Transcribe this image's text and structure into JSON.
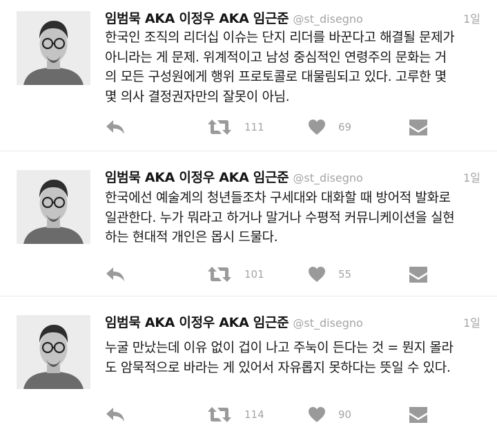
{
  "tweets": [
    {
      "author_name": "임범묵 AKA 이정우 AKA 임근준",
      "handle": "@st_disegno",
      "time": "1일",
      "lines": [
        "한국인 조직의 리더십 이슈는 단지 리더를 바꾼다고 해결될 문제가",
        "아니라는 게 문제. 위계적이고 남성 중심적인 연령주의 문화는 거",
        "의 모든 구성원에게 행위 프로토콜로 대물림되고 있다. 고루한 몇",
        "몇 의사 결정권자만의 잘못이 아님."
      ],
      "retweets": "111",
      "likes": "69"
    },
    {
      "author_name": "임범묵 AKA 이정우 AKA 임근준",
      "handle": "@st_disegno",
      "time": "1일",
      "lines": [
        "한국에선 예술계의 청년들조차 구세대와 대화할 때 방어적 발화로",
        "일관한다. 누가 뭐라고 하거나 말거나 수평적 커뮤니케이션을 실현",
        "하는 현대적 개인은 몹시 드물다."
      ],
      "retweets": "101",
      "likes": "55"
    },
    {
      "author_name": "임범묵 AKA 이정우 AKA 임근준",
      "handle": "@st_disegno",
      "time": "1일",
      "lines": [
        "누굴 만났는데 이유 없이 겁이 나고 주눅이 든다는 것 = 뭔지 몰라",
        "도 암묵적으로 바라는 게 있어서 자유롭지 못하다는 뜻일 수 있다."
      ],
      "retweets": "114",
      "likes": "90"
    }
  ],
  "icons": {
    "reply": "reply-icon",
    "retweet": "retweet-icon",
    "like": "heart-icon",
    "dm": "direct-message-icon"
  },
  "colors": {
    "icon": "#9a9a9a",
    "muted_text": "#a4a4a4",
    "divider": "#e1e8ed"
  }
}
